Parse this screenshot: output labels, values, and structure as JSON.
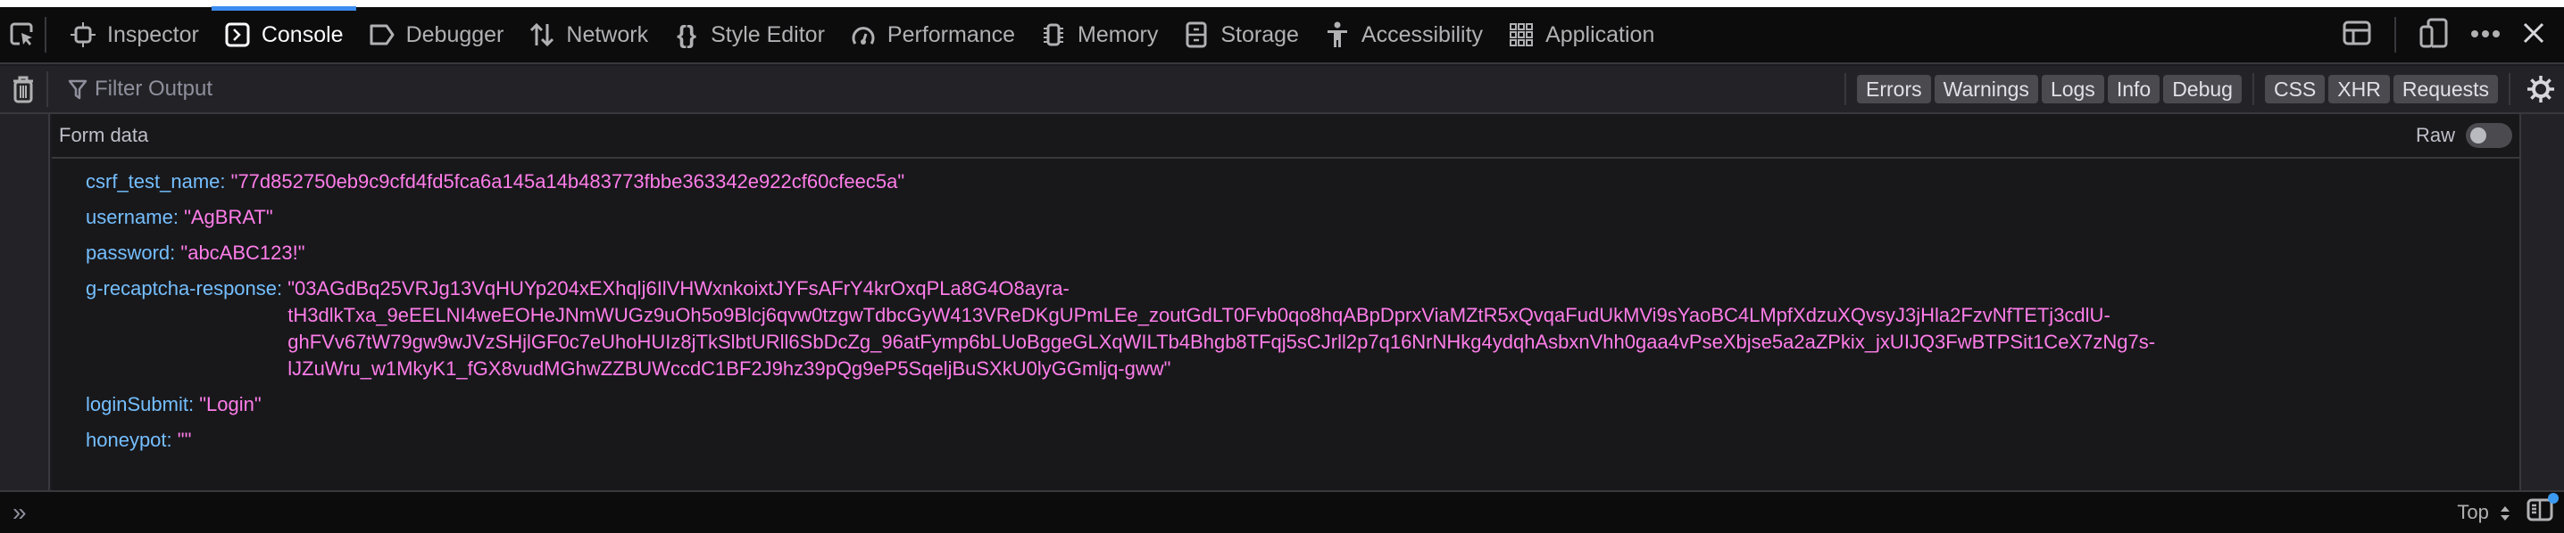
{
  "toolbar": {
    "tabs": [
      {
        "label": "Inspector",
        "icon": "inspector-icon"
      },
      {
        "label": "Console",
        "icon": "console-icon",
        "active": true
      },
      {
        "label": "Debugger",
        "icon": "debugger-icon"
      },
      {
        "label": "Network",
        "icon": "network-icon"
      },
      {
        "label": "Style Editor",
        "icon": "style-editor-icon"
      },
      {
        "label": "Performance",
        "icon": "performance-icon"
      },
      {
        "label": "Memory",
        "icon": "memory-icon"
      },
      {
        "label": "Storage",
        "icon": "storage-icon"
      },
      {
        "label": "Accessibility",
        "icon": "accessibility-icon"
      },
      {
        "label": "Application",
        "icon": "application-icon"
      }
    ],
    "accent_color": "#3c8cf0"
  },
  "filterbar": {
    "placeholder": "Filter Output",
    "level_filters": [
      "Errors",
      "Warnings",
      "Logs",
      "Info",
      "Debug"
    ],
    "type_filters": [
      "CSS",
      "XHR",
      "Requests"
    ]
  },
  "panel": {
    "title": "Form data",
    "raw_label": "Raw",
    "raw_enabled": false,
    "fields": [
      {
        "key": "csrf_test_name:",
        "value": "\"77d852750eb9c9cfd4fd5fca6a145a14b483773fbbe363342e922cf60cfeec5a\""
      },
      {
        "key": "username:",
        "value": "\"AgBRAT\""
      },
      {
        "key": "password:",
        "value": "\"abcABC123!\""
      },
      {
        "key": "g-recaptcha-response:",
        "value_lines": [
          "\"03AGdBq25VRJg13VqHUYp204xEXhqlj6IlVHWxnkoixtJYFsAFrY4krOxqPLa8G4O8ayra-",
          "tH3dlkTxa_9eEELNI4weEOHeJNmWUGz9uOh5o9Blcj6qvw0tzgwTdbcGyW413VReDKgUPmLEe_zoutGdLT0Fvb0qo8hqABpDprxViaMZtR5xQvqaFudUkMVi9sYaoBC4LMpfXdzuXQvsyJ3jHla2FzvNfTETj3cdlU-",
          "ghFVv67tW79gw9wJVzSHjlGF0c7eUhoHUIz8jTkSlbtURll6SbDcZg_96atFymp6bLUoBggeGLXqWILTb4Bhgb8TFqj5sCJrll2p7q16NrNHkg4ydqhAsbxnVhh0gaa4vPseXbjse5a2aZPkix_jxUIJQ3FwBTPSit1CeX7zNg7s-",
          "lJZuWru_w1MkyK1_fGX8vudMGhwZZBUWccdC1BF2J9hz39pQg9eP5SqeljBuSXkU0lyGGmljq-gww\""
        ]
      },
      {
        "key": "loginSubmit:",
        "value": "\"Login\""
      },
      {
        "key": "honeypot:",
        "value": "\"\""
      }
    ]
  },
  "inputbar": {
    "context_label": "Top"
  }
}
